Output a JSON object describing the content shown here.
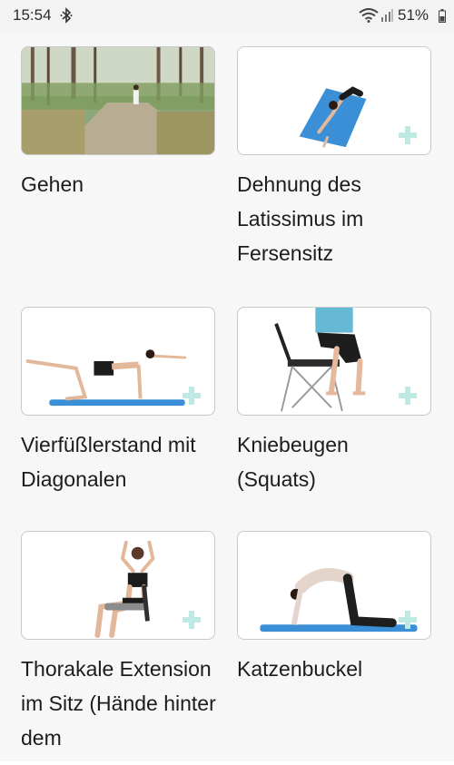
{
  "status_bar": {
    "time": "15:54",
    "battery": "51%",
    "icons": [
      "bluetooth-icon",
      "wifi-icon",
      "signal-icon",
      "battery-icon"
    ]
  },
  "exercises": [
    {
      "title": "Gehen"
    },
    {
      "title": "Dehnung des Latissimus im Fersensitz"
    },
    {
      "title": "Vierfüßlerstand mit Diagonalen"
    },
    {
      "title": "Kniebeugen (Squats)"
    },
    {
      "title": "Thorakale Extension im Sitz (Hände hinter dem"
    },
    {
      "title": "Katzenbuckel"
    }
  ],
  "colors": {
    "accent_plus": "#bfe9e3",
    "mat_blue": "#3a8fd6"
  }
}
